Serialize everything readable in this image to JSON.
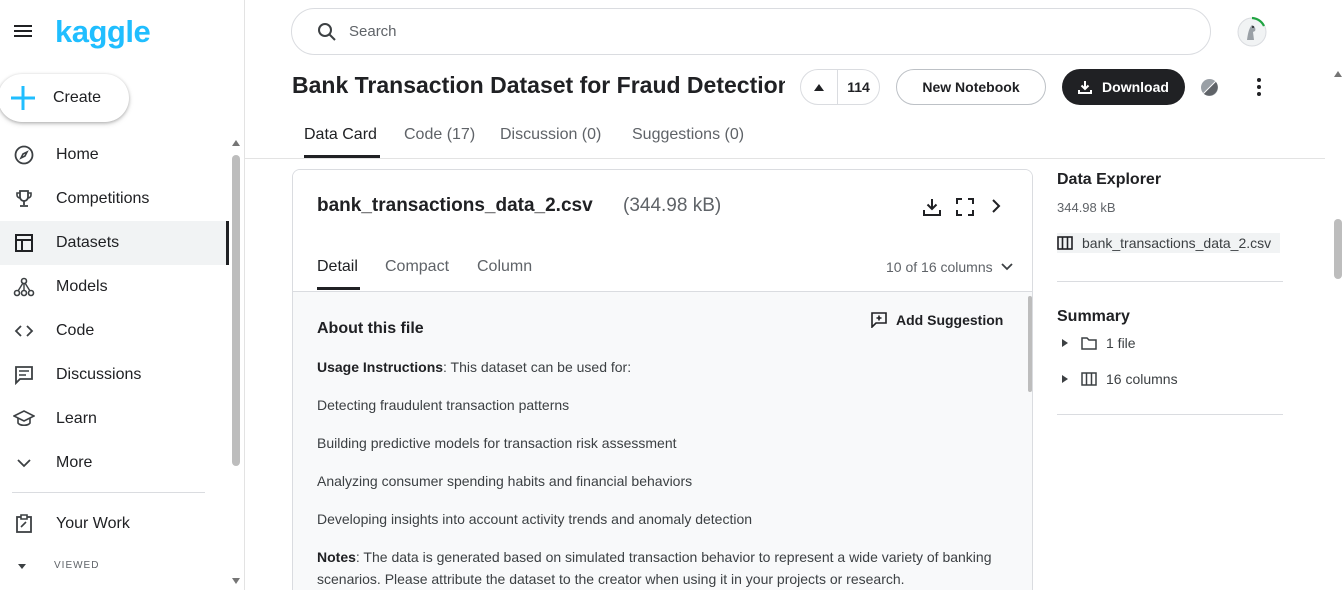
{
  "app": {
    "logo_text": "kaggle",
    "brand_color": "#20beff"
  },
  "sidebar": {
    "create_label": "Create",
    "items": [
      {
        "label": "Home",
        "icon": "compass-icon"
      },
      {
        "label": "Competitions",
        "icon": "trophy-icon"
      },
      {
        "label": "Datasets",
        "icon": "table-icon",
        "active": true
      },
      {
        "label": "Models",
        "icon": "models-icon"
      },
      {
        "label": "Code",
        "icon": "code-icon"
      },
      {
        "label": "Discussions",
        "icon": "discussion-icon"
      },
      {
        "label": "Learn",
        "icon": "school-icon"
      },
      {
        "label": "More",
        "icon": "chevron-down-icon"
      }
    ],
    "your_work_label": "Your Work",
    "viewed_label": "VIEWED"
  },
  "search": {
    "placeholder": "Search"
  },
  "dataset": {
    "title": "Bank Transaction Dataset for Fraud Detection",
    "vote_count": "114",
    "new_notebook_label": "New Notebook",
    "download_label": "Download"
  },
  "tabs": [
    {
      "label": "Data Card",
      "active": true
    },
    {
      "label": "Code (17)"
    },
    {
      "label": "Discussion (0)"
    },
    {
      "label": "Suggestions (0)"
    }
  ],
  "file": {
    "name": "bank_transactions_data_2.csv",
    "size": "(344.98 kB)",
    "view_tabs": [
      "Detail",
      "Compact",
      "Column"
    ],
    "columns_shown": "10 of 16 columns",
    "about_title": "About this file",
    "add_suggestion_label": "Add Suggestion",
    "usage_bold": "Usage Instructions",
    "usage_rest": ": This dataset can be used for:",
    "uses": [
      "Detecting fraudulent transaction patterns",
      "Building predictive models for transaction risk assessment",
      "Analyzing consumer spending habits and financial behaviors",
      "Developing insights into account activity trends and anomaly detection"
    ],
    "notes_bold": "Notes",
    "notes_rest": ": The data is generated based on simulated transaction behavior to represent a wide variety of banking scenarios. Please attribute the dataset to the creator when using it in your projects or research."
  },
  "data_explorer": {
    "title": "Data Explorer",
    "size": "344.98 kB",
    "file_name": "bank_transactions_data_2.csv",
    "summary_title": "Summary",
    "summary_files": "1 file",
    "summary_columns": "16 columns"
  }
}
